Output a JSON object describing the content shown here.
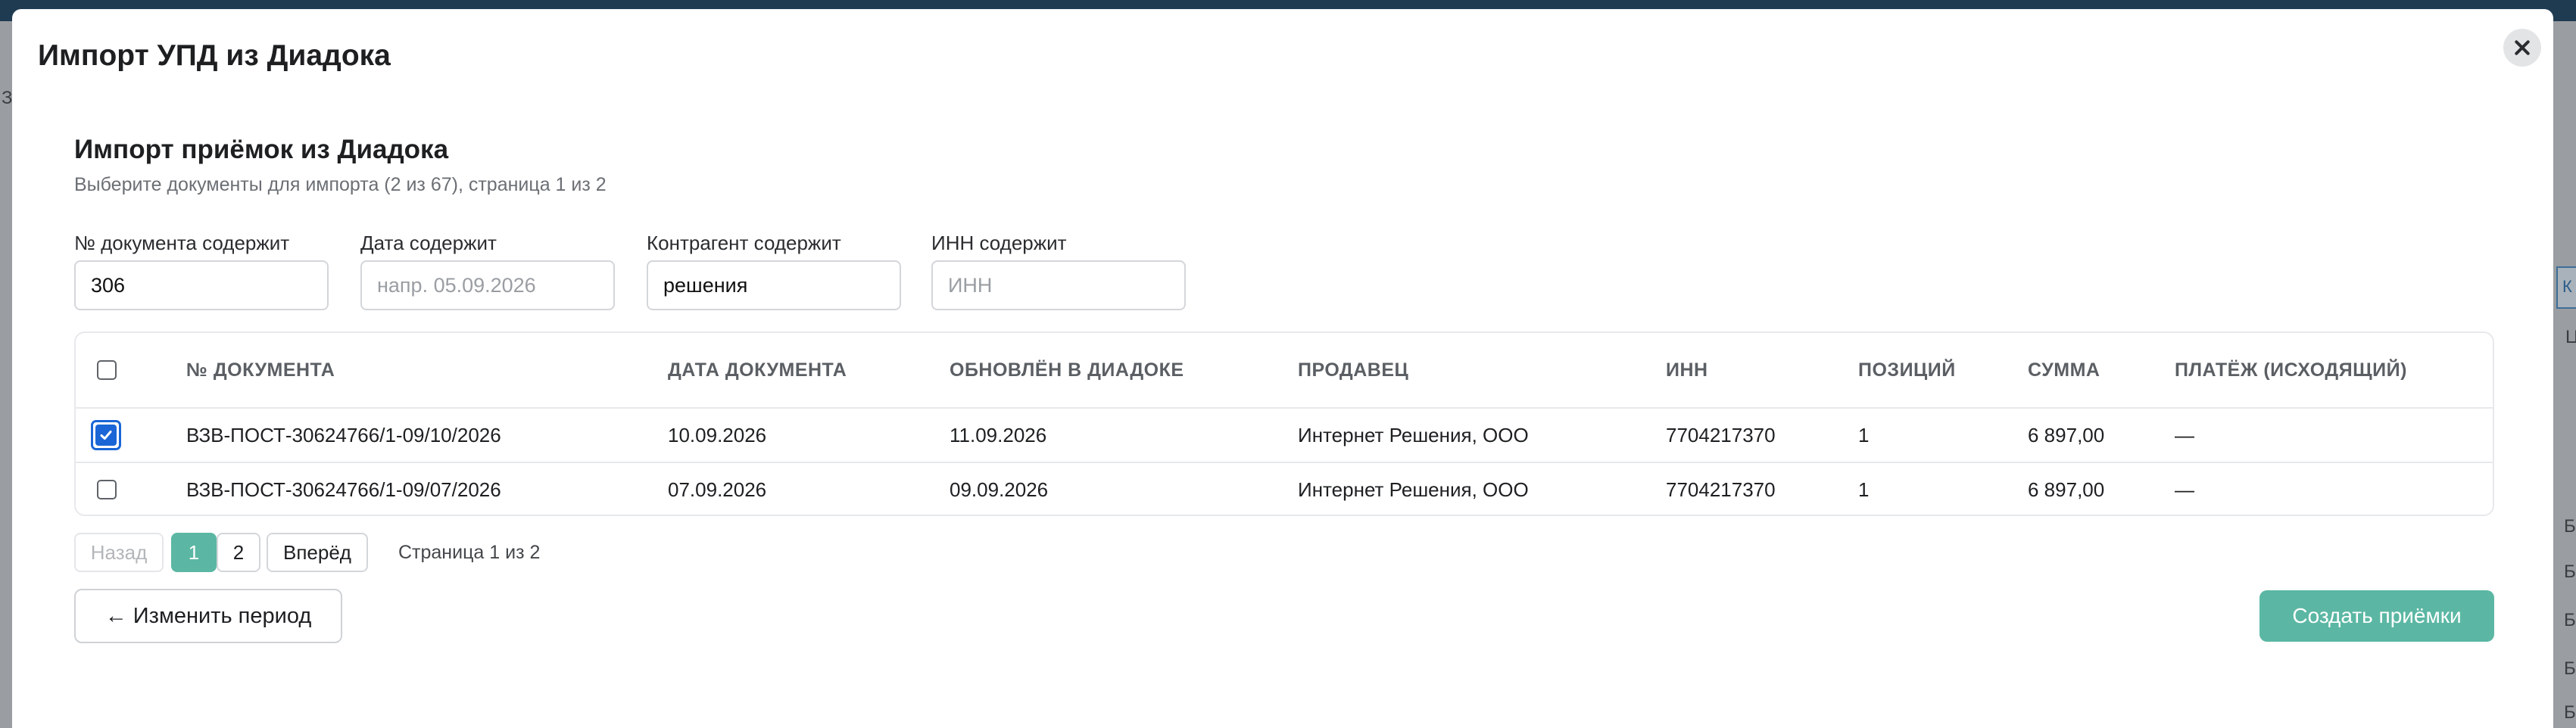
{
  "modal": {
    "title": "Импорт УПД из Диадока"
  },
  "section": {
    "title": "Импорт приёмок из Диадока",
    "subtitle": "Выберите документы для импорта (2 из 67), страница 1 из 2"
  },
  "filters": {
    "doc_number": {
      "label": "№ документа содержит",
      "value": "306",
      "placeholder": ""
    },
    "date": {
      "label": "Дата содержит",
      "value": "",
      "placeholder": "напр. 05.09.2026"
    },
    "counterparty": {
      "label": "Контрагент содержит",
      "value": "решения",
      "placeholder": ""
    },
    "inn": {
      "label": "ИНН содержит",
      "value": "",
      "placeholder": "ИНН"
    }
  },
  "table": {
    "columns": [
      "№ ДОКУМЕНТА",
      "ДАТА ДОКУМЕНТА",
      "ОБНОВЛЁН В ДИАДОКЕ",
      "ПРОДАВЕЦ",
      "ИНН",
      "ПОЗИЦИЙ",
      "СУММА",
      "ПЛАТЁЖ (ИСХОДЯЩИЙ)"
    ],
    "rows": [
      {
        "checked": true,
        "doc_number": "ВЗВ-ПОСТ-30624766/1-09/10/2026",
        "doc_date": "10.09.2026",
        "updated": "11.09.2026",
        "seller": "Интернет Решения, ООО",
        "inn": "7704217370",
        "positions": "1",
        "sum": "6 897,00",
        "payment": "—"
      },
      {
        "checked": false,
        "doc_number": "ВЗВ-ПОСТ-30624766/1-09/07/2026",
        "doc_date": "07.09.2026",
        "updated": "09.09.2026",
        "seller": "Интернет Решения, ООО",
        "inn": "7704217370",
        "positions": "1",
        "sum": "6 897,00",
        "payment": "—"
      }
    ]
  },
  "pagination": {
    "prev_label": "Назад",
    "pages": [
      "1",
      "2"
    ],
    "current_page": "1",
    "next_label": "Вперёд",
    "info": "Страница 1 из 2"
  },
  "actions": {
    "back_label": "← Изменить период",
    "create_label": "Создать приёмки"
  },
  "colors": {
    "accent": "#5bb7a3",
    "checkbox": "#1a66d6"
  },
  "background": {
    "fragments": [
      "З",
      "К",
      "Ц",
      "Б",
      "Б",
      "Б",
      "Б",
      "Б"
    ]
  }
}
